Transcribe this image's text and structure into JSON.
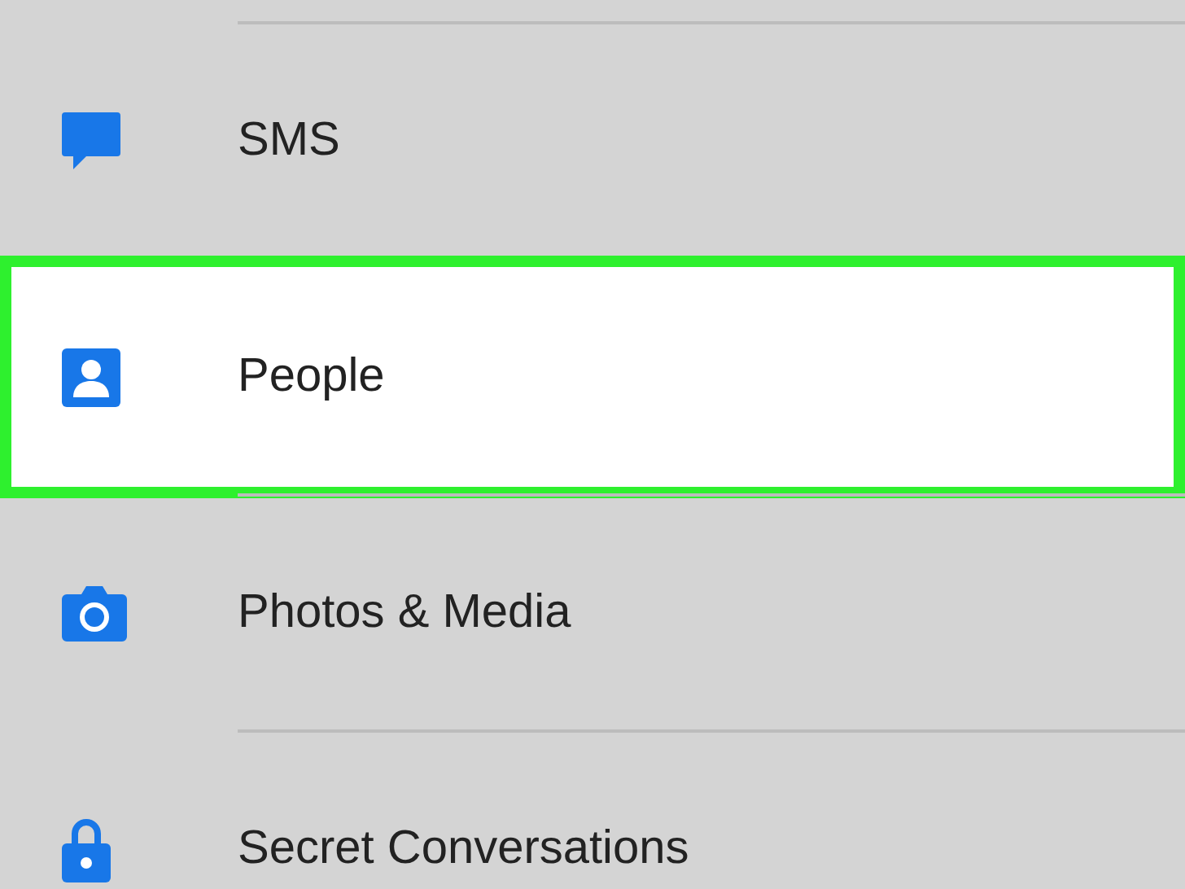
{
  "items": [
    {
      "kind": "sms",
      "label": "SMS",
      "highlighted": false
    },
    {
      "kind": "people",
      "label": "People",
      "highlighted": true
    },
    {
      "kind": "photos",
      "label": "Photos & Media",
      "highlighted": false
    },
    {
      "kind": "secret",
      "label": "Secret Conversations",
      "highlighted": false
    }
  ]
}
